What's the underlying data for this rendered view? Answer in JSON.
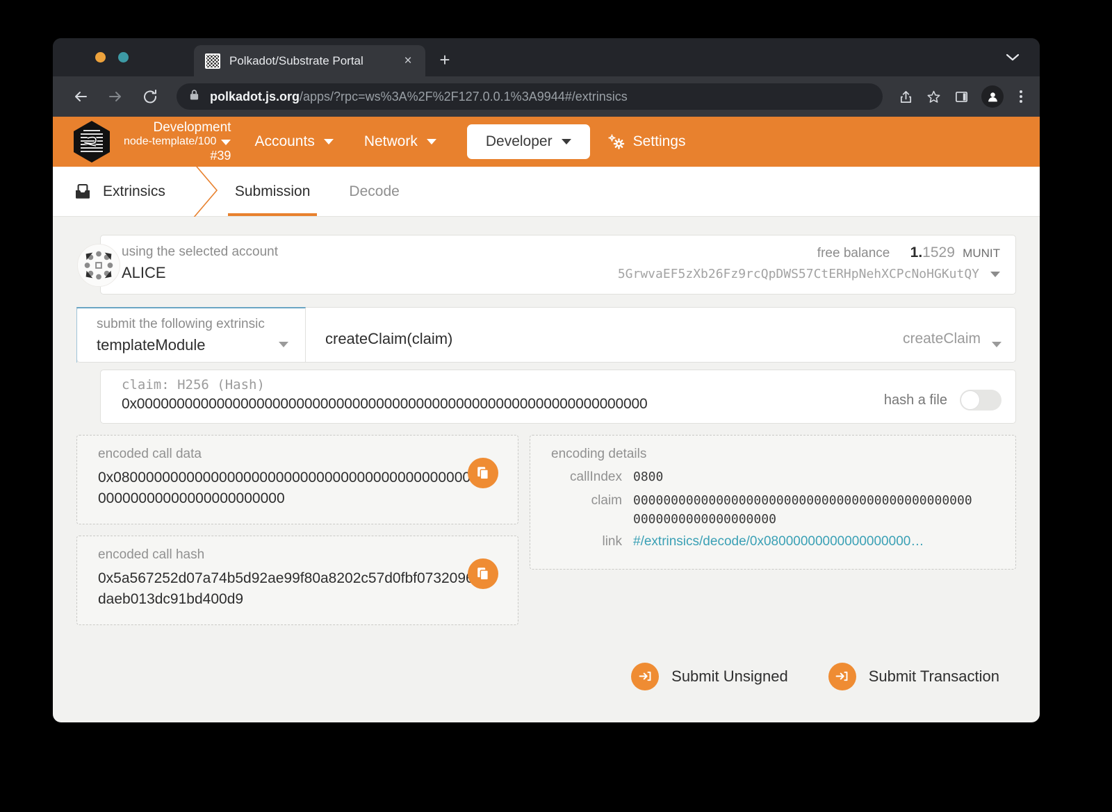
{
  "browser": {
    "tab_title": "Polkadot/Substrate Portal",
    "tab_close_label": "×",
    "new_tab_label": "+",
    "url_domain": "polkadot.js.org",
    "url_path": "/apps/?rpc=ws%3A%2F%2F127.0.0.1%3A9944#/extrinsics"
  },
  "appbar": {
    "chain_name": "Development",
    "chain_spec": "node-template/100",
    "chain_block": "#39",
    "nav": [
      {
        "label": "Accounts",
        "active": false
      },
      {
        "label": "Network",
        "active": false
      },
      {
        "label": "Developer",
        "active": true
      }
    ],
    "settings_label": "Settings"
  },
  "subnav": {
    "breadcrumb": "Extrinsics",
    "tabs": [
      {
        "label": "Submission",
        "active": true
      },
      {
        "label": "Decode",
        "active": false
      }
    ]
  },
  "account": {
    "label": "using the selected account",
    "name": "ALICE",
    "balance_label": "free balance",
    "balance_int": "1.",
    "balance_dec": "1529",
    "balance_unit": "MUNIT",
    "address": "5GrwvaEF5zXb26Fz9rcQpDWS57CtERHpNehXCPcNoHGKutQY"
  },
  "extrinsic": {
    "label": "submit the following extrinsic",
    "module": "templateModule",
    "method_signature": "createClaim(claim)",
    "method": "createClaim"
  },
  "claim": {
    "label": "claim: H256 (Hash)",
    "value": "0x0000000000000000000000000000000000000000000000000000000000000000",
    "hash_file_label": "hash a file",
    "hash_file_on": false
  },
  "encoded_call_data": {
    "title": "encoded call data",
    "value": "0x08000000000000000000000000000000000000000000000000000000000000000000"
  },
  "encoded_call_hash": {
    "title": "encoded call hash",
    "value": "0x5a567252d07a74b5d92ae99f80a8202c57d0fbf0732096daeb013dc91bd400d9"
  },
  "encoding_details": {
    "title": "encoding details",
    "rows": [
      {
        "key": "callIndex",
        "value": "0800",
        "is_link": false
      },
      {
        "key": "claim",
        "value": "0000000000000000000000000000000000000000000000000000000000000000",
        "is_link": false
      },
      {
        "key": "link",
        "value": "#/extrinsics/decode/0x08000000000000000000…",
        "is_link": true
      }
    ]
  },
  "actions": {
    "submit_unsigned": "Submit Unsigned",
    "submit_transaction": "Submit Transaction"
  },
  "colors": {
    "accent_orange": "#e8812e",
    "button_orange": "#ef8c33",
    "link_teal": "#3aa0b5",
    "page_background": "#f2f2f0"
  }
}
